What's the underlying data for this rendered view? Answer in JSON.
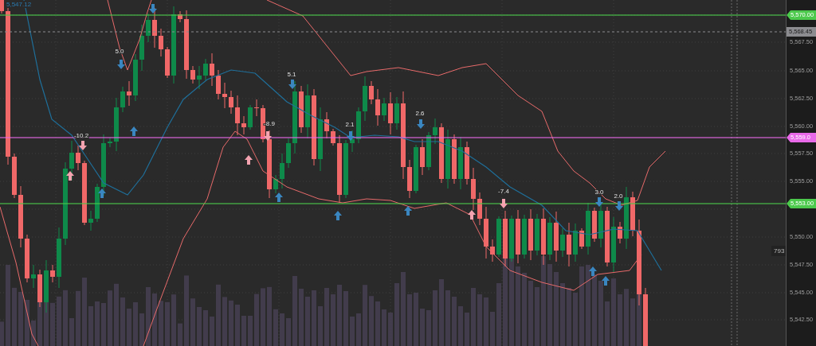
{
  "chart": {
    "last_price_label": "5,547.12",
    "signals": [
      {
        "label": "-10.2"
      },
      {
        "label": "5.0"
      },
      {
        "label": "-8.9"
      },
      {
        "label": "5.1"
      },
      {
        "label": "2.1"
      },
      {
        "label": "2.6"
      },
      {
        "label": "-7.4"
      },
      {
        "label": "3.0"
      },
      {
        "label": "2.0"
      }
    ],
    "volume_label": "793"
  },
  "price_axis": {
    "labels": [
      "5,567.50",
      "5,565.00",
      "5,562.50",
      "5,560.00",
      "5,557.50",
      "5,555.00",
      "5,550.00",
      "5,547.50",
      "5,545.00",
      "5,542.50"
    ],
    "price_lines": [
      {
        "value": "5,570.00",
        "kind": "level",
        "color": "#4cc94c"
      },
      {
        "value": "5,568.45",
        "kind": "cursor",
        "color": "#8c8c90"
      },
      {
        "value": "5,559.0",
        "kind": "level",
        "color": "#e86ae8"
      },
      {
        "value": "5,553.00",
        "kind": "level",
        "color": "#4cc94c"
      }
    ]
  }
}
